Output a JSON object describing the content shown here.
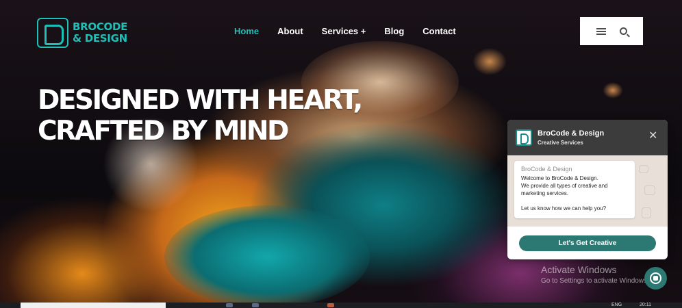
{
  "brand": {
    "line1": "BROCODE",
    "line2": "& DESIGN",
    "accent_color": "#1fc0b7",
    "icon": "brocode-logo-icon"
  },
  "nav": {
    "items": [
      {
        "label": "Home",
        "active": true
      },
      {
        "label": "About",
        "active": false
      },
      {
        "label": "Services +",
        "active": false
      },
      {
        "label": "Blog",
        "active": false
      },
      {
        "label": "Contact",
        "active": false
      }
    ]
  },
  "header_tools": {
    "menu_icon": "hamburger-menu-icon",
    "search_icon": "search-icon"
  },
  "hero": {
    "headline_line1": "DESIGNED WITH HEART,",
    "headline_line2": "CRAFTED BY MIND"
  },
  "chat": {
    "title": "BroCode & Design",
    "subtitle": "Creative Services",
    "close_icon": "close-icon",
    "message_sender": "BroCode & Design",
    "message_line1": "Welcome to BroCode & Design.",
    "message_line2": "We provide all types of creative and marketing services.",
    "message_line3": "Let us know how we can help you?",
    "cta_label": "Let's Get Creative",
    "header_color": "#3c3c3c",
    "cta_color": "#2c7873"
  },
  "watermark": {
    "title": "Activate Windows",
    "subtitle": "Go to Settings to activate Windows."
  },
  "whatsapp": {
    "icon": "whatsapp-icon"
  },
  "taskbar": {
    "lang": "ENG",
    "time": "20:11"
  }
}
